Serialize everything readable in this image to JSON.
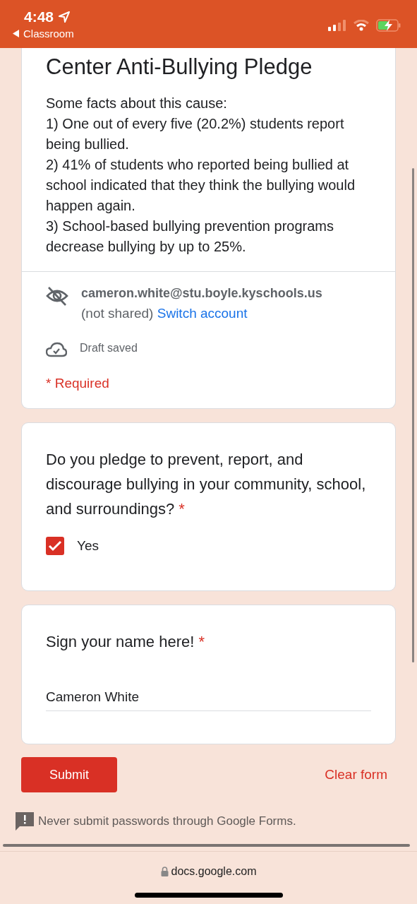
{
  "status_bar": {
    "time": "4:48",
    "back_label": "Classroom"
  },
  "header_card": {
    "title": "Center Anti-Bullying Pledge",
    "description_lines": [
      "Some facts about this cause:",
      "1) One out of every five (20.2%) students report being bullied.",
      "2) 41% of students who reported being bullied at school indicated that they think the bullying would happen again.",
      "3) School-based bullying prevention programs decrease bullying by up to 25%."
    ],
    "email": "cameron.white@stu.boyle.kyschools.us",
    "not_shared": "(not shared)",
    "switch_account": "Switch account",
    "draft_status": "Draft saved",
    "required_note": "* Required"
  },
  "questions": [
    {
      "kind": "checkbox",
      "title": "Do you pledge to prevent, report, and discourage bullying in your community, school, and surroundings?",
      "required_mark": "*",
      "options": [
        {
          "label": "Yes",
          "checked": true
        }
      ]
    },
    {
      "kind": "text",
      "title": "Sign your name here!",
      "required_mark": "*",
      "value": "Cameron White"
    }
  ],
  "actions": {
    "submit": "Submit",
    "clear": "Clear form"
  },
  "footer_note": "Never submit passwords through Google Forms.",
  "browser_bar": {
    "url": "docs.google.com"
  }
}
